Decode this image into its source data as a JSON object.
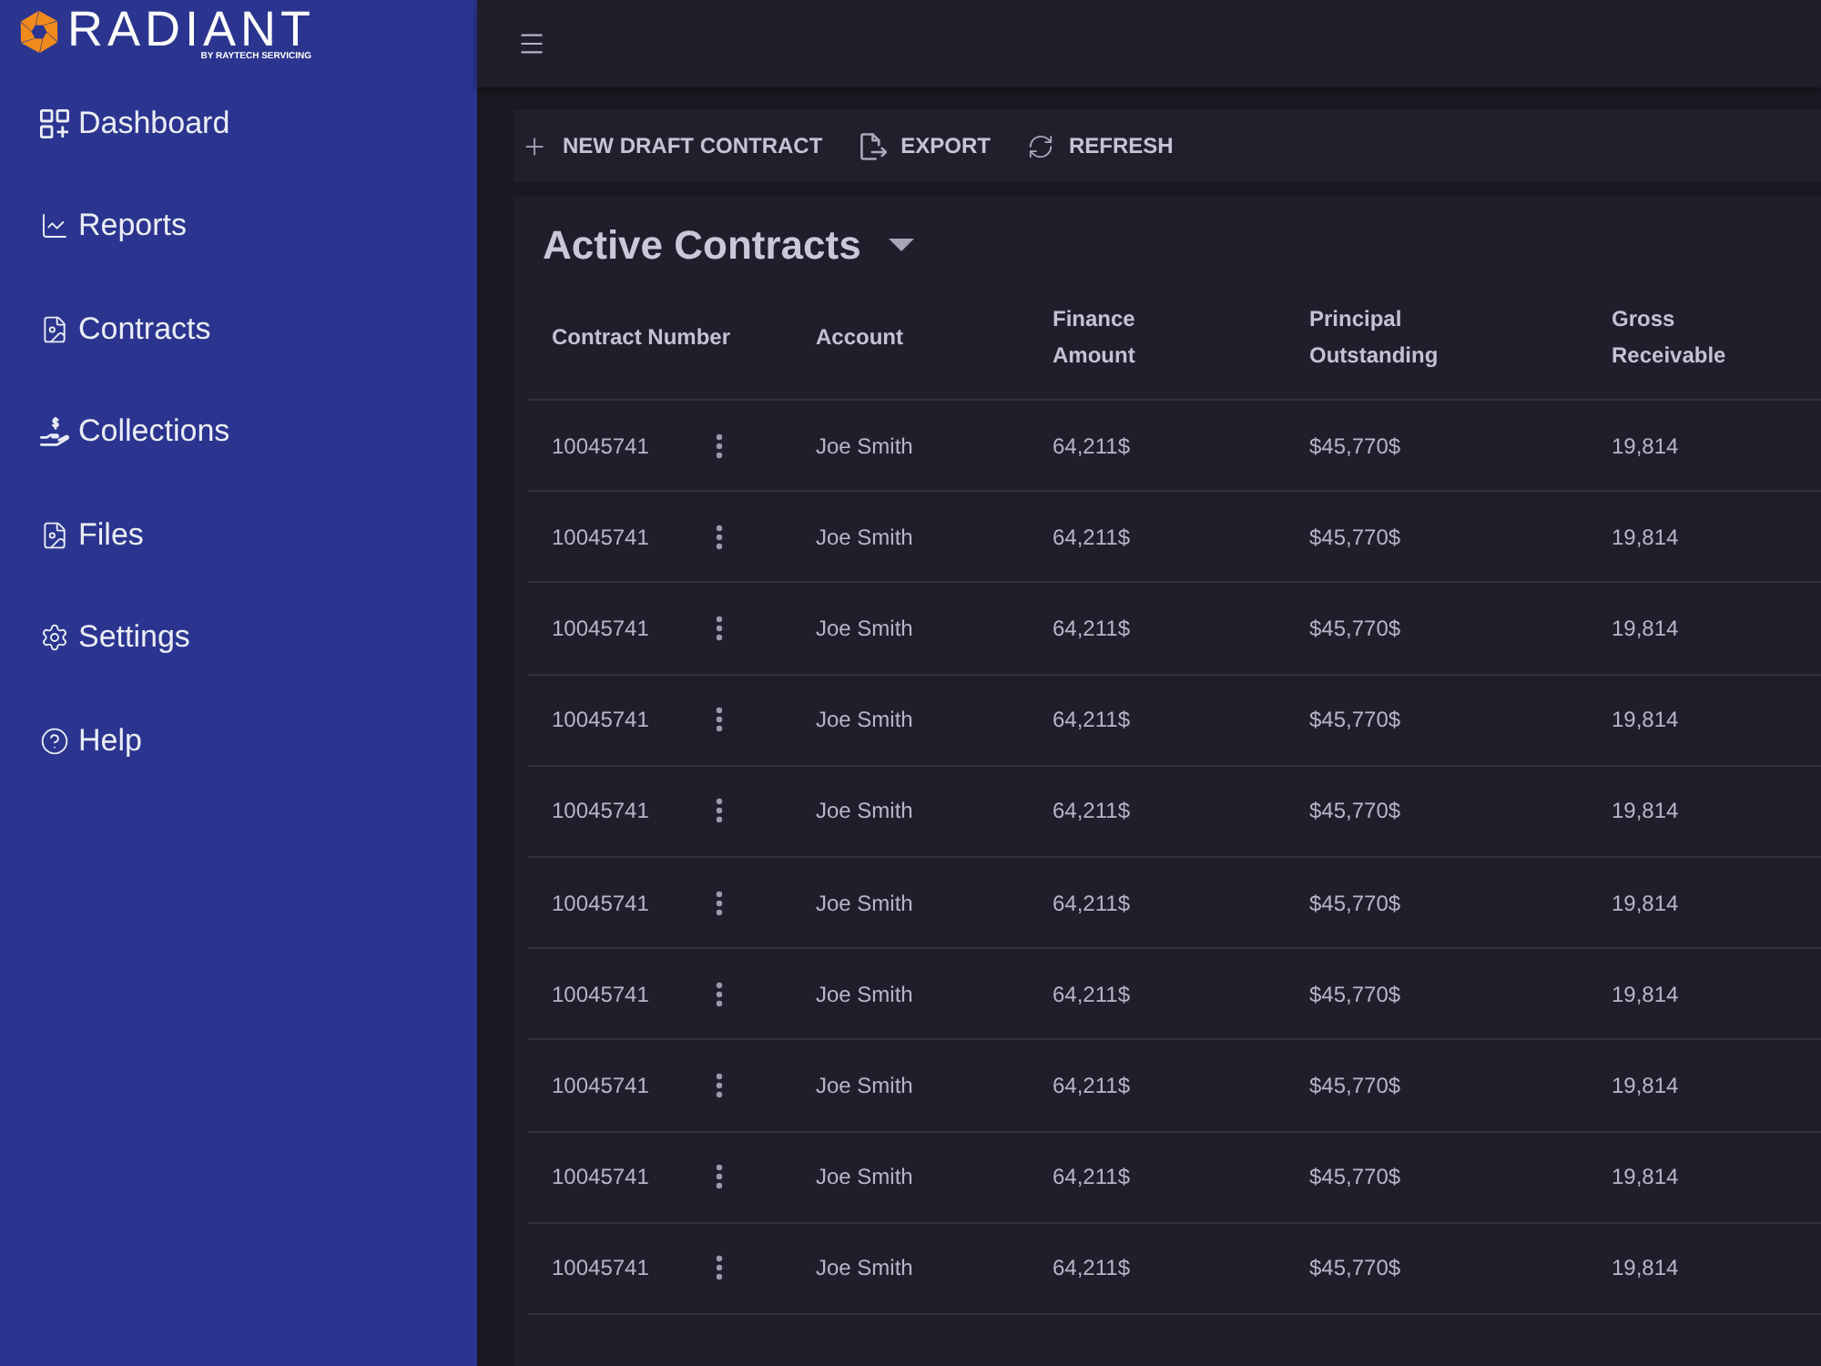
{
  "logo": {
    "name": "RADIANT",
    "tagline": "BY RAYTECH SERVICING"
  },
  "sidebar": {
    "items": [
      {
        "label": "Dashboard"
      },
      {
        "label": "Reports"
      },
      {
        "label": "Contracts"
      },
      {
        "label": "Collections"
      },
      {
        "label": "Files"
      },
      {
        "label": "Settings"
      },
      {
        "label": "Help"
      }
    ]
  },
  "toolbar": {
    "buttons": [
      {
        "label": "NEW DRAFT CONTRACT"
      },
      {
        "label": "EXPORT"
      },
      {
        "label": "REFRESH"
      }
    ]
  },
  "table": {
    "title": "Active Contracts",
    "columns": [
      "Contract Number",
      "Account",
      "Finance Amount",
      "Principal Outstanding",
      "Gross Receivable"
    ],
    "rows": [
      {
        "cells": [
          "10045741",
          "Joe Smith",
          "64,211$",
          "$45,770$",
          "19,814"
        ]
      },
      {
        "cells": [
          "10045741",
          "Joe Smith",
          "64,211$",
          "$45,770$",
          "19,814"
        ]
      },
      {
        "cells": [
          "10045741",
          "Joe Smith",
          "64,211$",
          "$45,770$",
          "19,814"
        ]
      },
      {
        "cells": [
          "10045741",
          "Joe Smith",
          "64,211$",
          "$45,770$",
          "19,814"
        ]
      },
      {
        "cells": [
          "10045741",
          "Joe Smith",
          "64,211$",
          "$45,770$",
          "19,814"
        ]
      },
      {
        "cells": [
          "10045741",
          "Joe Smith",
          "64,211$",
          "$45,770$",
          "19,814"
        ]
      },
      {
        "cells": [
          "10045741",
          "Joe Smith",
          "64,211$",
          "$45,770$",
          "19,814"
        ]
      },
      {
        "cells": [
          "10045741",
          "Joe Smith",
          "64,211$",
          "$45,770$",
          "19,814"
        ]
      },
      {
        "cells": [
          "10045741",
          "Joe Smith",
          "64,211$",
          "$45,770$",
          "19,814"
        ]
      },
      {
        "cells": [
          "10045741",
          "Joe Smith",
          "64,211$",
          "$45,770$",
          "19,814"
        ]
      }
    ]
  }
}
